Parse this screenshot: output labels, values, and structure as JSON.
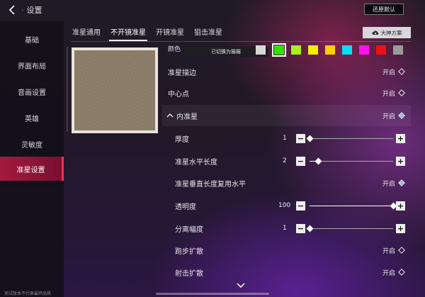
{
  "header": {
    "title": "设置",
    "reset_label": "还原默认"
  },
  "sidebar": {
    "items": [
      {
        "label": "基础",
        "active": false
      },
      {
        "label": "界面布局",
        "active": false
      },
      {
        "label": "音画设置",
        "active": false
      },
      {
        "label": "英雄",
        "active": false
      },
      {
        "label": "灵敏度",
        "active": false
      },
      {
        "label": "准星设置",
        "active": true
      }
    ]
  },
  "tabs": [
    {
      "label": "准星通用",
      "active": false
    },
    {
      "label": "不开镜准星",
      "active": true
    },
    {
      "label": "开镜准星",
      "active": false
    },
    {
      "label": "狙击准星",
      "active": false
    }
  ],
  "plan_button": {
    "label": "大神方案",
    "icon": "cloud-download-icon"
  },
  "color_row": {
    "label": "颜色",
    "tooltip": "已切换为猫猫",
    "swatches": [
      "#d8d8d8",
      "#33e000",
      "#a8f020",
      "#f0f000",
      "#ffd000",
      "#00e0f0",
      "#ff10f0",
      "#ee1010",
      "#9a9a9a"
    ],
    "selected_index": 1
  },
  "rows": {
    "outline": {
      "label": "准星描边",
      "state": "开启"
    },
    "center_dot": {
      "label": "中心点",
      "state": "开启"
    },
    "inner": {
      "label": "内准星",
      "state": "开启",
      "expanded": true
    },
    "thickness": {
      "label": "厚度",
      "value": "1",
      "level": 0.0
    },
    "h_length": {
      "label": "准星水平长度",
      "value": "2",
      "level": 0.1
    },
    "v_reuse": {
      "label": "准星垂直长度复用水平",
      "state": "开启"
    },
    "opacity": {
      "label": "透明度",
      "value": "100",
      "level": 1.0
    },
    "separation": {
      "label": "分离幅度",
      "value": "1",
      "level": 0.0
    },
    "run_spread": {
      "label": "跑步扩散",
      "state": "开启"
    },
    "fire_spread": {
      "label": "射击扩散",
      "state": "开启"
    }
  },
  "footer": {
    "note": "测试版本不代表最终品质"
  }
}
